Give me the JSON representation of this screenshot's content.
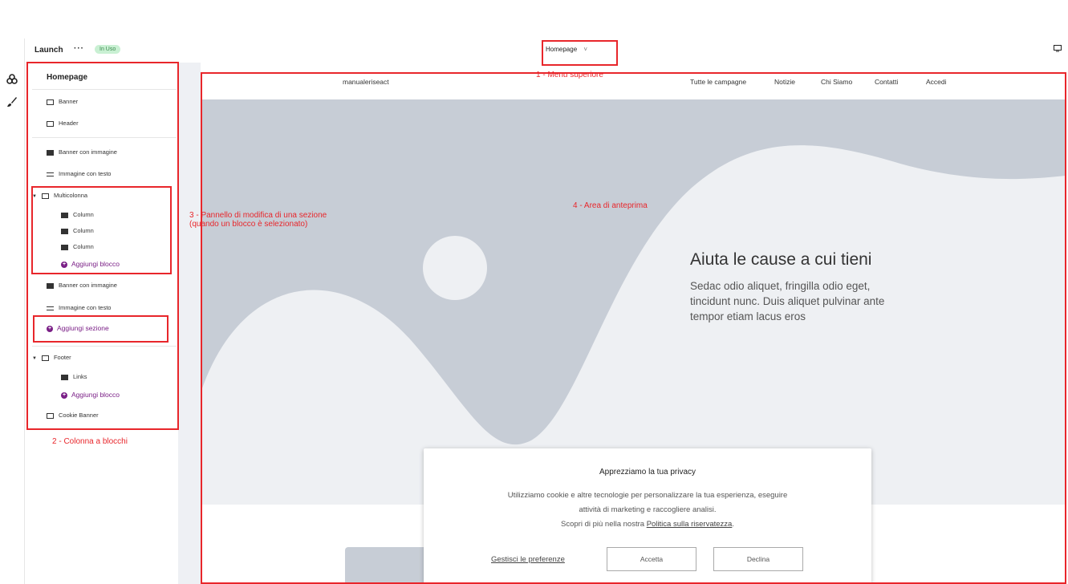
{
  "topbar": {
    "back_icon": "chevron-left-icon",
    "site_name": "Launch",
    "more": "···",
    "status_badge": "In Uso",
    "page_select": "Homepage",
    "page_select_chevron": "˅",
    "device_icon": "monitor-icon"
  },
  "rail": {
    "icons": [
      "sections-icon",
      "brush-icon"
    ]
  },
  "panel": {
    "title": "Homepage",
    "items": [
      {
        "label": "Banner",
        "icon": "banner-icon"
      },
      {
        "label": "Header",
        "icon": "banner-icon"
      },
      {
        "label": "Banner con immagine",
        "icon": "image-icon"
      },
      {
        "label": "Immagine con testo",
        "icon": "text-icon"
      },
      {
        "label": "Multicolonna",
        "icon": "columns-icon",
        "expanded": true
      },
      {
        "label": "Column",
        "icon": "block-icon"
      },
      {
        "label": "Column",
        "icon": "block-icon"
      },
      {
        "label": "Column",
        "icon": "block-icon"
      },
      {
        "label": "Aggiungi blocco",
        "icon": "add-icon"
      },
      {
        "label": "Banner con immagine",
        "icon": "image-icon"
      },
      {
        "label": "Immagine con testo",
        "icon": "text-icon"
      },
      {
        "label": "Aggiungi sezione",
        "icon": "add-icon"
      },
      {
        "label": "Footer",
        "icon": "banner-icon",
        "expanded": true
      },
      {
        "label": "Links",
        "icon": "block-icon"
      },
      {
        "label": "Aggiungi blocco",
        "icon": "add-icon"
      },
      {
        "label": "Cookie Banner",
        "icon": "banner-icon"
      }
    ]
  },
  "annotations": {
    "a1": "1 - Menu superiore",
    "a2": "2 - Colonna a blocchi",
    "a3_line1": "3 - Pannello di modifica di una sezione",
    "a3_line2": "(quando un blocco è selezionato)",
    "a4": "4 - Area di anteprima",
    "color": "#e8262b"
  },
  "preview": {
    "brand": "manualeriseact",
    "nav": [
      "Tutte le campagne",
      "Notizie",
      "Chi Siamo",
      "Contatti",
      "Accedi"
    ],
    "hero_title": "Aiuta le cause a cui tieni",
    "hero_text": "Sedac odio aliquet, fringilla odio eget, tincidunt nunc. Duis aliquet pulvinar ante tempor etiam lacus eros"
  },
  "cookie": {
    "title": "Apprezziamo la tua privacy",
    "line1": "Utilizziamo cookie e altre tecnologie per personalizzare la tua esperienza, eseguire",
    "line2": "attività di marketing e raccogliere analisi.",
    "line3_prefix": "Scopri di più nella nostra ",
    "policy_link": "Politica sulla riservatezza",
    "line3_suffix": ".",
    "manage": "Gestisci le preferenze",
    "accept": "Accetta",
    "decline": "Declina"
  },
  "colors": {
    "accent": "#7a1f86",
    "badge_bg": "#c9f0d3",
    "hero_bg": "#c7cdd6",
    "hero_shape": "#eef0f3"
  }
}
